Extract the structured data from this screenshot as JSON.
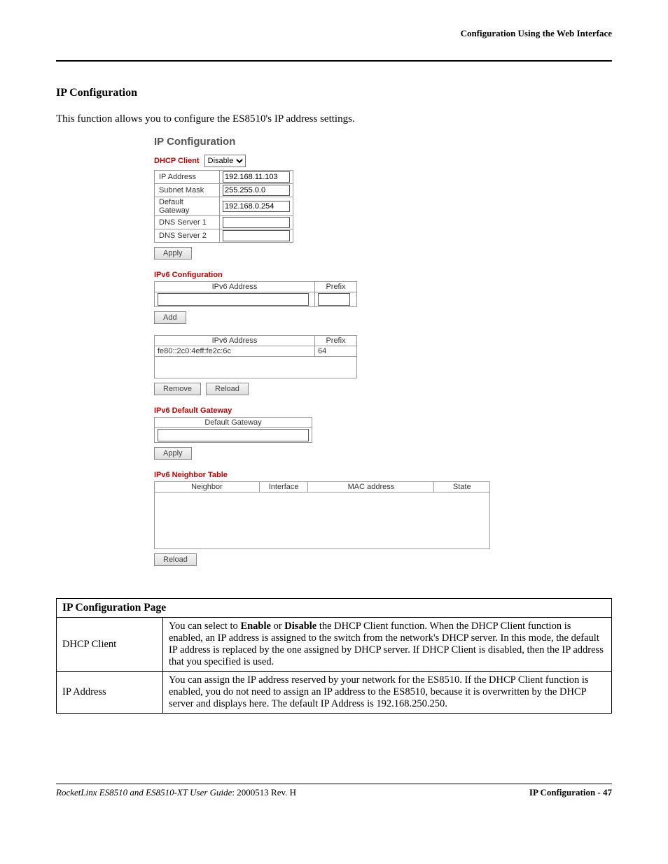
{
  "header_right": "Configuration Using the Web Interface",
  "section_heading": "IP Configuration",
  "intro": "This function allows you to configure the ES8510's IP address settings.",
  "ui": {
    "title": "IP Configuration",
    "dhcp_label": "DHCP Client",
    "dhcp_value": "Disable",
    "rows": {
      "ip_label": "IP Address",
      "ip_value": "192.168.11.103",
      "mask_label": "Subnet Mask",
      "mask_value": "255.255.0.0",
      "gw_label": "Default Gateway",
      "gw_value": "192.168.0.254",
      "dns1_label": "DNS Server 1",
      "dns1_value": "",
      "dns2_label": "DNS Server 2",
      "dns2_value": ""
    },
    "apply_btn": "Apply",
    "v6conf_label": "IPv6 Configuration",
    "v6_addr_col": "IPv6 Address",
    "v6_prefix_col": "Prefix",
    "add_btn": "Add",
    "v6_entry_addr": "fe80::2c0:4eff:fe2c:6c",
    "v6_entry_prefix": "64",
    "remove_btn": "Remove",
    "reload_btn": "Reload",
    "v6gw_label": "IPv6 Default Gateway",
    "gw_col": "Default Gateway",
    "v6nt_label": "IPv6 Neighbor Table",
    "nt_cols": {
      "c1": "Neighbor",
      "c2": "Interface",
      "c3": "MAC address",
      "c4": "State"
    }
  },
  "desc": {
    "header": "IP Configuration Page",
    "r1_param": "DHCP Client",
    "r1_pre": "You can select to ",
    "r1_b1": "Enable",
    "r1_mid": " or ",
    "r1_b2": "Disable",
    "r1_post": " the DHCP Client function. When the DHCP Client function is enabled, an IP address is assigned to the switch from the network's DHCP server. In this mode, the default IP address is replaced by the one assigned by DHCP server. If DHCP Client is disabled, then the IP address that you specified is used.",
    "r2_param": "IP Address",
    "r2_text": "You can assign the IP address reserved by your network for the ES8510. If the DHCP Client function is enabled, you do not need to assign an IP address to the ES8510, because it is overwritten by the DHCP server and displays here. The default IP Address is 192.168.250.250."
  },
  "footer": {
    "left_italic": "RocketLinx ES8510  and ES8510-XT User Guide",
    "left_rest": ": 2000513 Rev. H",
    "right": "IP Configuration - 47"
  }
}
